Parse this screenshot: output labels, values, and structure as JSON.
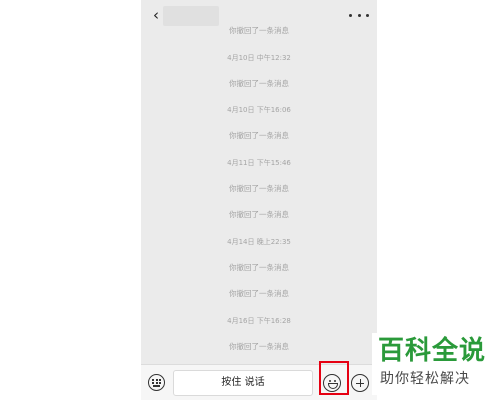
{
  "header": {
    "back_symbol": "‹",
    "more_icon": "more-dots-icon"
  },
  "messages": [
    {
      "type": "notice",
      "text": "你撤回了一条消息"
    },
    {
      "type": "time",
      "text": "4月10日 中午12:32"
    },
    {
      "type": "notice",
      "text": "你撤回了一条消息"
    },
    {
      "type": "time",
      "text": "4月10日 下午16:06"
    },
    {
      "type": "notice",
      "text": "你撤回了一条消息"
    },
    {
      "type": "time",
      "text": "4月11日 下午15:46"
    },
    {
      "type": "notice",
      "text": "你撤回了一条消息"
    },
    {
      "type": "notice",
      "text": "你撤回了一条消息"
    },
    {
      "type": "time",
      "text": "4月14日 晚上22:35"
    },
    {
      "type": "notice",
      "text": "你撤回了一条消息"
    },
    {
      "type": "notice",
      "text": "你撤回了一条消息"
    },
    {
      "type": "time",
      "text": "4月16日 下午16:28"
    },
    {
      "type": "notice",
      "text": "你撤回了一条消息"
    }
  ],
  "input_bar": {
    "keyboard_icon": "keyboard-icon",
    "hold_to_talk_label": "按住 说话",
    "emoji_icon": "emoji-icon",
    "plus_icon": "plus-icon"
  },
  "highlight_color": "#e60012",
  "watermark": {
    "title": "百科全说",
    "subtitle": "助你轻松解决",
    "color": "#2a9a3a"
  }
}
